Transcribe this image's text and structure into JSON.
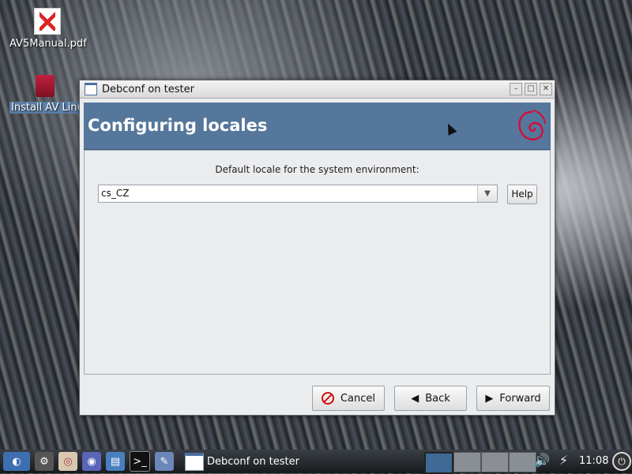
{
  "desktop": {
    "icons": [
      {
        "label": "AV5Manual.pdf",
        "icon": "pdf-icon"
      },
      {
        "label": "Install AV Linu",
        "icon": "book-icon"
      }
    ]
  },
  "window": {
    "title": "Debconf on tester",
    "controls": {
      "minimize": "–",
      "maximize": "□",
      "close": "✕"
    },
    "banner_heading": "Configuring locales",
    "banner_logo": "debian-swirl-logo",
    "prompt": "Default locale for the system environment:",
    "locale_value": "cs_CZ",
    "help_label": "Help",
    "buttons": {
      "cancel": "Cancel",
      "back": "Back",
      "forward": "Forward"
    }
  },
  "taskbar": {
    "launchers": [
      "start-menu-icon",
      "system-settings-icon",
      "debian-icon",
      "web-browser-icon",
      "file-manager-icon",
      "terminal-icon",
      "text-editor-icon"
    ],
    "task_label": "Debconf on tester",
    "clock": "11:08",
    "tray": [
      "volume-icon",
      "network-icon",
      "power-icon"
    ]
  },
  "colors": {
    "banner": "#55779c",
    "accent": "#d0103a"
  }
}
